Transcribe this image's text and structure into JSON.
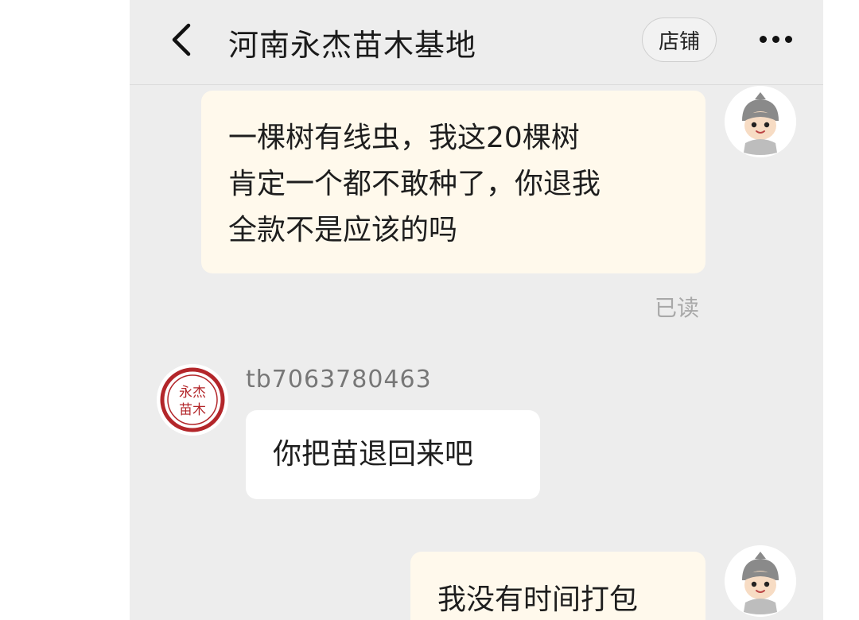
{
  "header": {
    "title": "河南永杰苗木基地",
    "store_button": "店铺",
    "back_icon": "chevron-left-icon",
    "more_icon": "more-dots-icon"
  },
  "messages": [
    {
      "sender": "me",
      "lines": [
        "一棵树有线虫，我这20棵树",
        "肯定一个都不敢种了，你退我",
        "全款不是应该的吗"
      ],
      "status": "已读"
    },
    {
      "sender": "shop",
      "sender_name": "tb7063780463",
      "avatar_text": [
        "永杰",
        "苗木"
      ],
      "text": "你把苗退回来吧"
    },
    {
      "sender": "me",
      "text": "我没有时间打包"
    }
  ],
  "colors": {
    "background": "#ededed",
    "my_bubble": "#fff9ec",
    "their_bubble": "#ffffff",
    "seal_red": "#b3262a"
  }
}
